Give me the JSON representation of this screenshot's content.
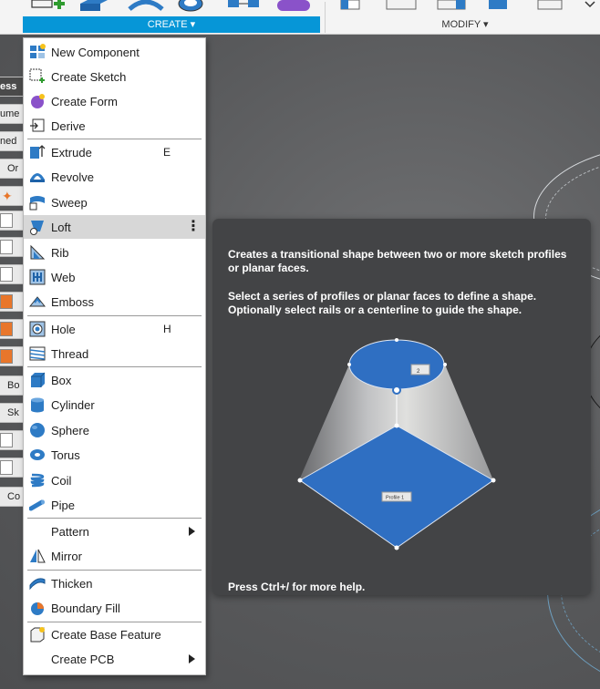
{
  "toolbar": {
    "groups": [
      {
        "label": "CREATE ▾"
      },
      {
        "label": "MODIFY ▾"
      }
    ]
  },
  "browser_panel": {
    "rows": [
      "ess",
      "ume",
      "ned",
      "Or",
      "",
      "",
      "",
      "",
      "",
      "",
      "",
      "Bo",
      "Sk",
      "",
      "",
      "Co"
    ]
  },
  "menu": {
    "items": [
      {
        "label": "New Component",
        "icon": "new-component-icon"
      },
      {
        "label": "Create Sketch",
        "icon": "create-sketch-icon"
      },
      {
        "label": "Create Form",
        "icon": "create-form-icon"
      },
      {
        "label": "Derive",
        "icon": "derive-icon"
      },
      {
        "label": "Extrude",
        "icon": "extrude-icon",
        "shortcut": "E"
      },
      {
        "label": "Revolve",
        "icon": "revolve-icon"
      },
      {
        "label": "Sweep",
        "icon": "sweep-icon"
      },
      {
        "label": "Loft",
        "icon": "loft-icon",
        "highlighted": true,
        "more": "⋮"
      },
      {
        "label": "Rib",
        "icon": "rib-icon"
      },
      {
        "label": "Web",
        "icon": "web-icon"
      },
      {
        "label": "Emboss",
        "icon": "emboss-icon"
      },
      {
        "label": "Hole",
        "icon": "hole-icon",
        "shortcut": "H"
      },
      {
        "label": "Thread",
        "icon": "thread-icon"
      },
      {
        "label": "Box",
        "icon": "box-icon"
      },
      {
        "label": "Cylinder",
        "icon": "cylinder-icon"
      },
      {
        "label": "Sphere",
        "icon": "sphere-icon"
      },
      {
        "label": "Torus",
        "icon": "torus-icon"
      },
      {
        "label": "Coil",
        "icon": "coil-icon"
      },
      {
        "label": "Pipe",
        "icon": "pipe-icon"
      },
      {
        "label": "Pattern",
        "submenu": true
      },
      {
        "label": "Mirror",
        "icon": "mirror-icon"
      },
      {
        "label": "Thicken",
        "icon": "thicken-icon"
      },
      {
        "label": "Boundary Fill",
        "icon": "boundary-fill-icon"
      },
      {
        "label": "Create Base Feature",
        "icon": "create-base-feature-icon"
      },
      {
        "label": "Create PCB",
        "submenu": true
      }
    ]
  },
  "tooltip": {
    "description": "Creates a transitional shape between two or more sketch profiles or planar faces.",
    "instructions": "Select a series of profiles or planar faces to define a shape. Optionally select rails or a centerline to guide the shape.",
    "help": "Press Ctrl+/ for more help.",
    "illustration_label": "Profile 1",
    "illustration_small_label": "2"
  },
  "colors": {
    "accent": "#0696d7",
    "tooltip_bg": "#434446",
    "loft_blue": "#2f6fc2",
    "menu_highlight": "#d7d7d7"
  }
}
